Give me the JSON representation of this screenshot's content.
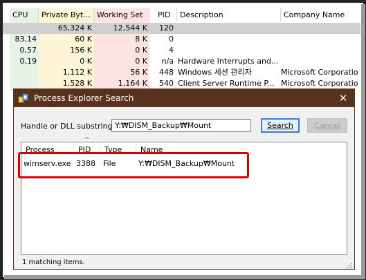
{
  "process_table": {
    "headers": {
      "cpu": "CPU",
      "private_bytes": "Private Byt...",
      "working_set": "Working Set",
      "pid": "PID",
      "description": "Description",
      "company": "Company Name"
    },
    "rows": [
      {
        "cpu": "",
        "private_bytes": "65,324 K",
        "working_set": "12,544 K",
        "pid": "120",
        "description": "",
        "company": ""
      },
      {
        "cpu": "83,14",
        "private_bytes": "60 K",
        "working_set": "8 K",
        "pid": "0",
        "description": "",
        "company": ""
      },
      {
        "cpu": "0,57",
        "private_bytes": "156 K",
        "working_set": "0 K",
        "pid": "4",
        "description": "",
        "company": ""
      },
      {
        "cpu": "0,19",
        "private_bytes": "0 K",
        "working_set": "0 K",
        "pid": "n/a",
        "description": "Hardware Interrupts and...",
        "company": ""
      },
      {
        "cpu": "",
        "private_bytes": "1,112 K",
        "working_set": "56 K",
        "pid": "448",
        "description": "Windows 세션 관리자",
        "company": "Microsoft Corporatio"
      },
      {
        "cpu": "",
        "private_bytes": "1,528 K",
        "working_set": "1,164 K",
        "pid": "540",
        "description": "Client Server Runtime P...",
        "company": "Microsoft Corporatio"
      }
    ]
  },
  "dialog": {
    "title": "Process Explorer Search",
    "close_glyph": "✕",
    "substring_label": "Handle or DLL substring:",
    "substring_value": "Y:₩DISM_Backup₩Mount",
    "search_button": "Search",
    "cancel_button": "Cancel",
    "columns": {
      "process": "Process",
      "pid": "PID",
      "type": "Type",
      "name": "Name",
      "sort_glyph": "^"
    },
    "results": [
      {
        "process": "wimserv.exe",
        "pid": "3388",
        "type": "File",
        "name": "Y:₩DISM_Backup₩Mount"
      }
    ],
    "status": "1 matching items."
  },
  "colors": {
    "titlebar": "#57321f",
    "highlight_box": "#d40000",
    "cpu_col": "#e6f3e6",
    "private_col": "#fff6d8",
    "working_col": "#fde4e0"
  }
}
